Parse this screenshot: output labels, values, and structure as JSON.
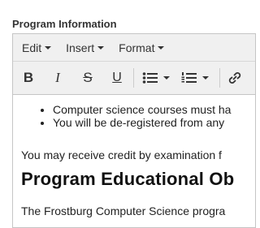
{
  "field": {
    "label": "Program Information"
  },
  "menubar": {
    "items": [
      "Edit",
      "Insert",
      "Format"
    ]
  },
  "toolbar": {
    "bold_label": "B",
    "italic_label": "I",
    "strike_label": "S",
    "underline_label": "U"
  },
  "content": {
    "bullets": [
      "Computer science courses must ha",
      "You will be de-registered from any"
    ],
    "paragraph1": "You may receive credit by examination f",
    "heading": "Program Educational Ob",
    "paragraph2": "The Frostburg Computer Science progra"
  }
}
